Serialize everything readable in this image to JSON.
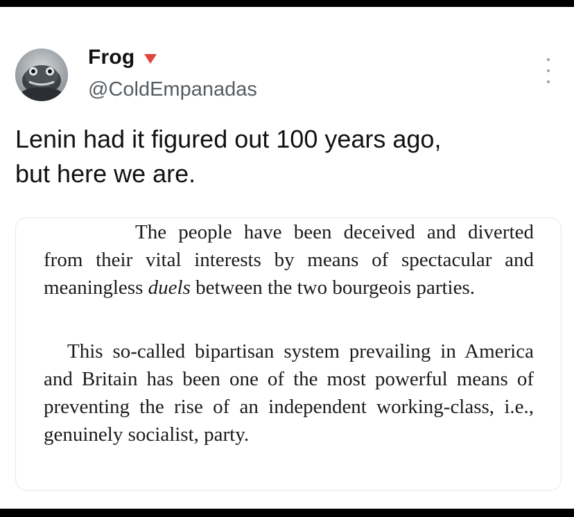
{
  "tweet": {
    "author_name": "Frog",
    "handle": "@ColdEmpanadas",
    "text": "Lenin had it figured out 100 years ago,\nbut here we are.",
    "accent_color": "#e0453a"
  },
  "quote": {
    "paragraph1": "The people have been deceived and diverted from their vital interests by means of spectacular and meaningless duels between the two bourgeois parties.",
    "paragraph2": "This so-called bipartisan system prevailing in America and Britain has been one of the most powerful means of preventing the rise of an independent working-class, i.e., genuinely socialist, party."
  },
  "icons": {
    "avatar": "frog-avatar",
    "dropdown": "chevron-down-icon",
    "more": "more-vertical-icon"
  }
}
